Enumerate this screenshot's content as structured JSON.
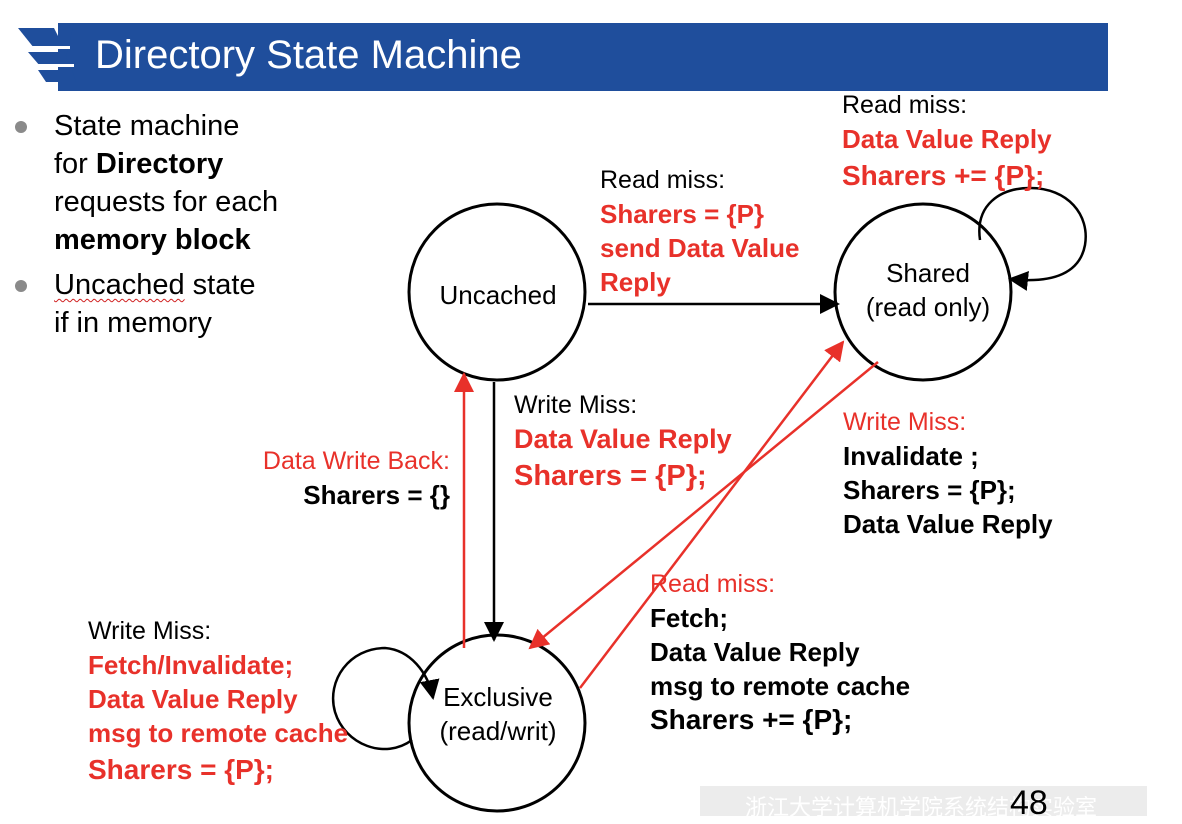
{
  "slide": {
    "title": "Directory State Machine",
    "page_number": "48",
    "footer_text": "浙江大学计算机学院系统结构实验室"
  },
  "bullets": [
    {
      "lines": [
        [
          "State machine"
        ],
        [
          "for ",
          {
            "b": "Directory"
          }
        ],
        [
          "requests for each"
        ],
        [
          {
            "b": "memory block"
          }
        ]
      ]
    },
    {
      "lines": [
        [
          {
            "w": "Uncached"
          },
          " state"
        ],
        [
          "if in memory"
        ]
      ]
    }
  ],
  "bullet_text": {
    "b1_l1": "State machine",
    "b1_l2_pre": "for ",
    "b1_l2_bold": "Directory",
    "b1_l3": "requests for each",
    "b1_l4_bold": "memory block",
    "b2_l1_wavy": "Uncached",
    "b2_l1_rest": " state",
    "b2_l2": "if in memory"
  },
  "states": {
    "uncached": "Uncached",
    "shared_l1": "Shared",
    "shared_l2": "(read only)",
    "exclusive_l1": "Exclusive",
    "exclusive_l2": "(read/writ)"
  },
  "transitions": {
    "uncached_to_shared": {
      "event": "Read miss:",
      "actions": [
        "Sharers = {P}",
        "send Data Value",
        "Reply"
      ]
    },
    "shared_self": {
      "event": "Read miss:",
      "actions": [
        "Data Value Reply",
        "Sharers += {P};"
      ]
    },
    "uncached_to_exclusive": {
      "event": "Write Miss:",
      "actions": [
        "Data Value Reply",
        "Sharers = {P};"
      ]
    },
    "exclusive_to_uncached": {
      "event": "Data Write Back:",
      "actions": [
        "Sharers = {}"
      ]
    },
    "shared_to_exclusive": {
      "event": "Write Miss:",
      "actions": [
        "Invalidate ;",
        "Sharers = {P};",
        "Data Value  Reply"
      ]
    },
    "exclusive_to_shared": {
      "event": "Read miss:",
      "actions": [
        "Fetch;",
        "Data Value Reply",
        "msg to remote cache",
        "Sharers += {P};"
      ]
    },
    "exclusive_self": {
      "event": "Write Miss:",
      "actions": [
        "Fetch/Invalidate;",
        "Data Value Reply",
        "msg to remote cache",
        "Sharers = {P};"
      ]
    }
  },
  "colors": {
    "banner": "#1f4e9c",
    "red": "#e8312a",
    "black": "#000000",
    "bullet": "#8a8a8a"
  }
}
